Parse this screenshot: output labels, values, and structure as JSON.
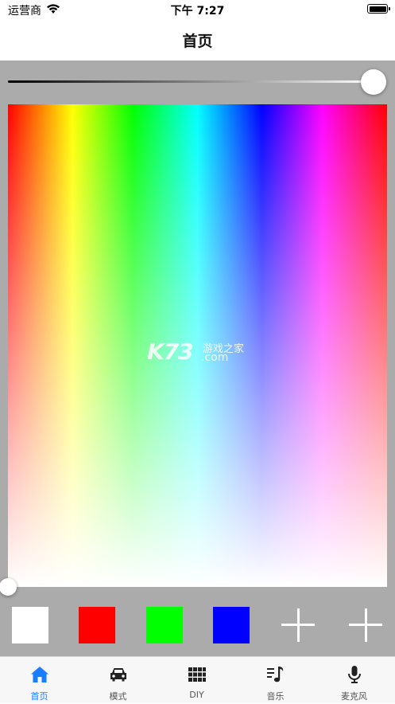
{
  "status_bar": {
    "carrier": "运营商",
    "time": "下午 7:27",
    "battery_level": 1.0
  },
  "nav": {
    "title": "首页"
  },
  "brightness_slider": {
    "value": 1.0
  },
  "color_palette": {
    "selector_x": 0.0,
    "selector_y": 1.0
  },
  "watermark": {
    "logo": "K73",
    "text": "游戏之家",
    "domain": ".com"
  },
  "swatches": [
    {
      "name": "white",
      "color": "#ffffff"
    },
    {
      "name": "red",
      "color": "#ff0000"
    },
    {
      "name": "green",
      "color": "#00ff00"
    },
    {
      "name": "blue",
      "color": "#0000ff"
    },
    {
      "name": "add",
      "color": null
    },
    {
      "name": "add",
      "color": null
    }
  ],
  "tabs": [
    {
      "label": "首页",
      "icon": "home-icon",
      "active": true
    },
    {
      "label": "模式",
      "icon": "car-icon",
      "active": false
    },
    {
      "label": "DIY",
      "icon": "grid-icon",
      "active": false
    },
    {
      "label": "音乐",
      "icon": "music-note-icon",
      "active": false
    },
    {
      "label": "麦克风",
      "icon": "microphone-icon",
      "active": false
    }
  ],
  "colors": {
    "accent": "#1a7dff",
    "content_bg": "#ababab",
    "tab_inactive": "#222222"
  }
}
